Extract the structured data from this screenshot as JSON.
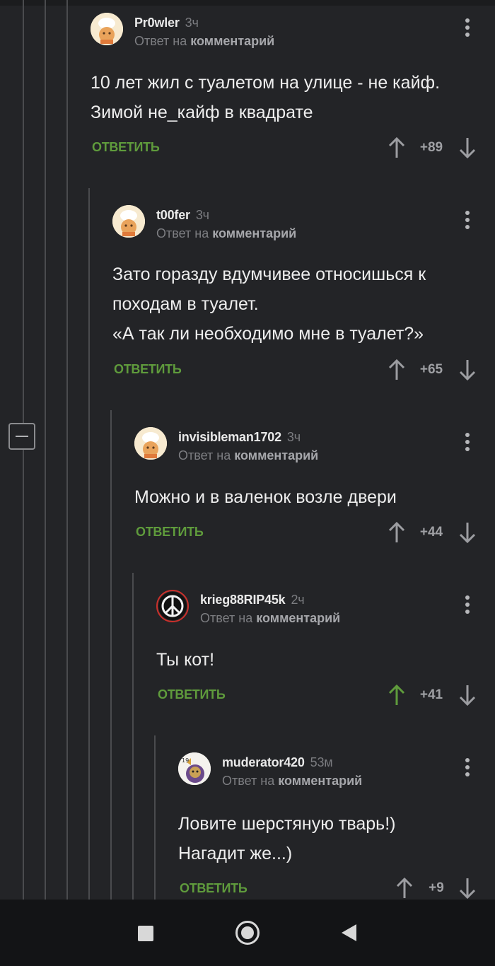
{
  "comments": [
    {
      "username": "Pr0wler",
      "time": "3ч",
      "reply_prefix": "Ответ на",
      "reply_target": "комментарий",
      "text": "10 лет жил с туалетом на улице - не кайф.\nЗимой не_кайф в квадрате",
      "reply_label": "ОТВЕТИТЬ",
      "score": "+89",
      "upvoted": false,
      "avatar": "chef-avatar"
    },
    {
      "username": "t00fer",
      "time": "3ч",
      "reply_prefix": "Ответ на",
      "reply_target": "комментарий",
      "text": "Зато  горазду вдумчивее относишься к\nпоходам в туалет.\n«А так ли необходимо мне в туалет?»",
      "reply_label": "ОТВЕТИТЬ",
      "score": "+65",
      "upvoted": false,
      "avatar": "chef-avatar"
    },
    {
      "username": "invisibleman1702",
      "time": "3ч",
      "reply_prefix": "Ответ на",
      "reply_target": "комментарий",
      "text": "Можно и в валенок возле двери",
      "reply_label": "ОТВЕТИТЬ",
      "score": "+44",
      "upvoted": false,
      "avatar": "chef-avatar"
    },
    {
      "username": "krieg88RIP45k",
      "time": "2ч",
      "reply_prefix": "Ответ на",
      "reply_target": "комментарий",
      "text": "Ты кот!",
      "reply_label": "ОТВЕТИТЬ",
      "score": "+41",
      "upvoted": true,
      "avatar": "peace-sign-avatar"
    },
    {
      "username": "muderator420",
      "time": "53м",
      "reply_prefix": "Ответ на",
      "reply_target": "комментарий",
      "text": "Ловите шерстяную тварь!)\nНагадит же...)",
      "reply_label": "ОТВЕТИТЬ",
      "score": "+9",
      "upvoted": false,
      "avatar": "cartoon-avatar"
    }
  ],
  "colors": {
    "background": "#232427",
    "reply_green": "#5f9b3c",
    "upvote_active": "#5f9b3c",
    "muted_text": "#7d7e82"
  },
  "navbar": {
    "icons": [
      "recent-apps-icon",
      "home-icon",
      "back-icon"
    ]
  }
}
